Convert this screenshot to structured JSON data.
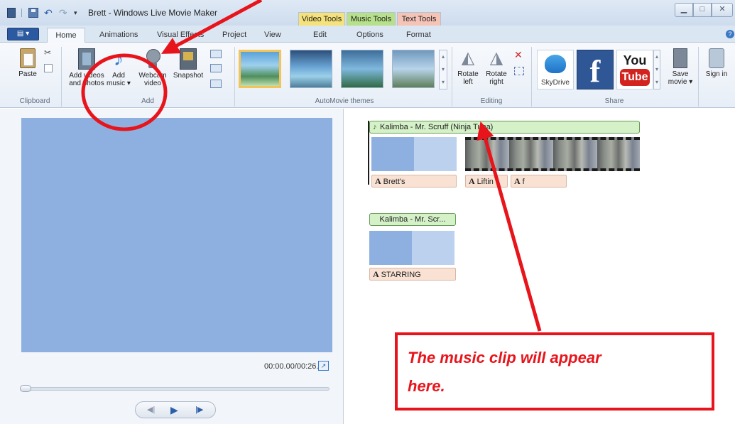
{
  "window": {
    "title": "Brett - Windows Live Movie Maker",
    "context_tabs": [
      "Video Tools",
      "Music Tools",
      "Text Tools"
    ]
  },
  "tabs": [
    "Home",
    "Animations",
    "Visual Effects",
    "Project",
    "View",
    "Edit",
    "Options",
    "Format"
  ],
  "ribbon": {
    "clipboard": {
      "paste_label": "Paste",
      "group_label": "Clipboard"
    },
    "add": {
      "add_videos_label": "Add videos and photos",
      "add_music_label": "Add music ▾",
      "webcam_label": "Webcam video",
      "snapshot_label": "Snapshot",
      "group_label": "Add"
    },
    "themes": {
      "group_label": "AutoMovie themes"
    },
    "editing": {
      "rotate_left_label": "Rotate left",
      "rotate_right_label": "Rotate right",
      "group_label": "Editing"
    },
    "share": {
      "skydrive_label": "SkyDrive",
      "facebook_label": "f",
      "youtube_you": "You",
      "youtube_tube": "Tube",
      "save_movie_label": "Save movie ▾",
      "sign_in_label": "Sign in",
      "group_label": "Share"
    }
  },
  "preview": {
    "time": "00:00.00/00:26.33"
  },
  "storyboard": {
    "music_clip_1": "Kalimba - Mr. Scruff (Ninja Tuna)",
    "music_clip_2": "Kalimba - Mr. Scr...",
    "captions": [
      "Brett's",
      "Liftin",
      "f",
      "STARRING"
    ],
    "caption_glyph": "A"
  },
  "annotation": {
    "note_line_1": "The music clip will appear",
    "note_line_2": "here."
  },
  "colors": {
    "annotation_red": "#e8141b",
    "preview_blue": "#8eb0e0",
    "music_green": "#d5f1c8",
    "caption_peach": "#f9e2d3"
  }
}
